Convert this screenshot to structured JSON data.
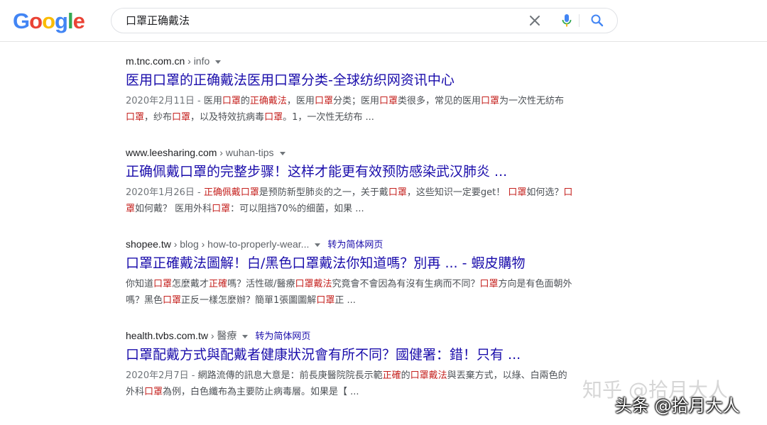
{
  "header": {
    "logo": "Google",
    "search": {
      "value": "口罩正确戴法",
      "placeholder": ""
    }
  },
  "results": [
    {
      "domain": "m.tnc.com.cn",
      "path": " › info",
      "translate": "",
      "title": "医用口罩的正确戴法医用口罩分类-全球纺织网资讯中心",
      "snippet_html": "<span class=\"date\">2020年2月11日 - </span>医用<span class=\"hl\">口罩</span>的<span class=\"hl\">正确戴法</span>，医用<span class=\"hl\">口罩</span>分类；医用<span class=\"hl\">口罩</span>类很多，常见的医用<span class=\"hl\">口罩</span>为一次性无纺布<span class=\"hl\">口罩</span>，纱布<span class=\"hl\">口罩</span>，以及特效抗病毒<span class=\"hl\">口罩</span>。1，一次性无纺布 ..."
    },
    {
      "domain": "www.leesharing.com",
      "path": " › wuhan-tips",
      "translate": "",
      "title": "正确佩戴口罩的完整步骤！这样才能更有效预防感染武汉肺炎 ...",
      "snippet_html": "<span class=\"date\">2020年1月26日 - </span><span class=\"hl\">正确佩戴口罩</span>是预防新型肺炎的之一，关于戴<span class=\"hl\">口罩</span>，这些知识一定要get！ <span class=\"hl\">口罩</span>如何选？<span class=\"hl\">口罩</span>如何戴？ 医用外科<span class=\"hl\">口罩</span>：可以阻挡70%的细菌，如果 ..."
    },
    {
      "domain": "shopee.tw",
      "path": " › blog › how-to-properly-wear...",
      "translate": "转为简体网页",
      "title": "口罩正確戴法圖解！白/黑色口罩戴法你知道嗎？別再 ... - 蝦皮購物",
      "snippet_html": "你知道<span class=\"hl\">口罩</span>怎麼戴才<span class=\"hl\">正確</span>嗎？活性碳/醫療<span class=\"hl\">口罩戴法</span>究竟會不會因為有沒有生病而不同？<span class=\"hl\">口罩</span>方向是有色面朝外嗎？黑色<span class=\"hl\">口罩</span>正反一樣怎麼辦？簡單1張圖圖解<span class=\"hl\">口罩</span>正 ..."
    },
    {
      "domain": "health.tvbs.com.tw",
      "path": " › 醫療",
      "translate": "转为简体网页",
      "title": "口罩配戴方式與配戴者健康狀況會有所不同？國健署：錯！只有 ...",
      "snippet_html": "<span class=\"date\">2020年2月7日 - </span>網路流傳的訊息大意是：前長庚醫院院長示範<span class=\"hl\">正確</span>的<span class=\"hl\">口罩戴法</span>與丟棄方式，以綠、白兩色的外科<span class=\"hl\">口罩</span>為例，白色纖布為主要防止病毒層。如果是【 ..."
    }
  ],
  "watermark": {
    "faint": "知乎 @拾月大人",
    "main": "头条 @拾月大人"
  }
}
